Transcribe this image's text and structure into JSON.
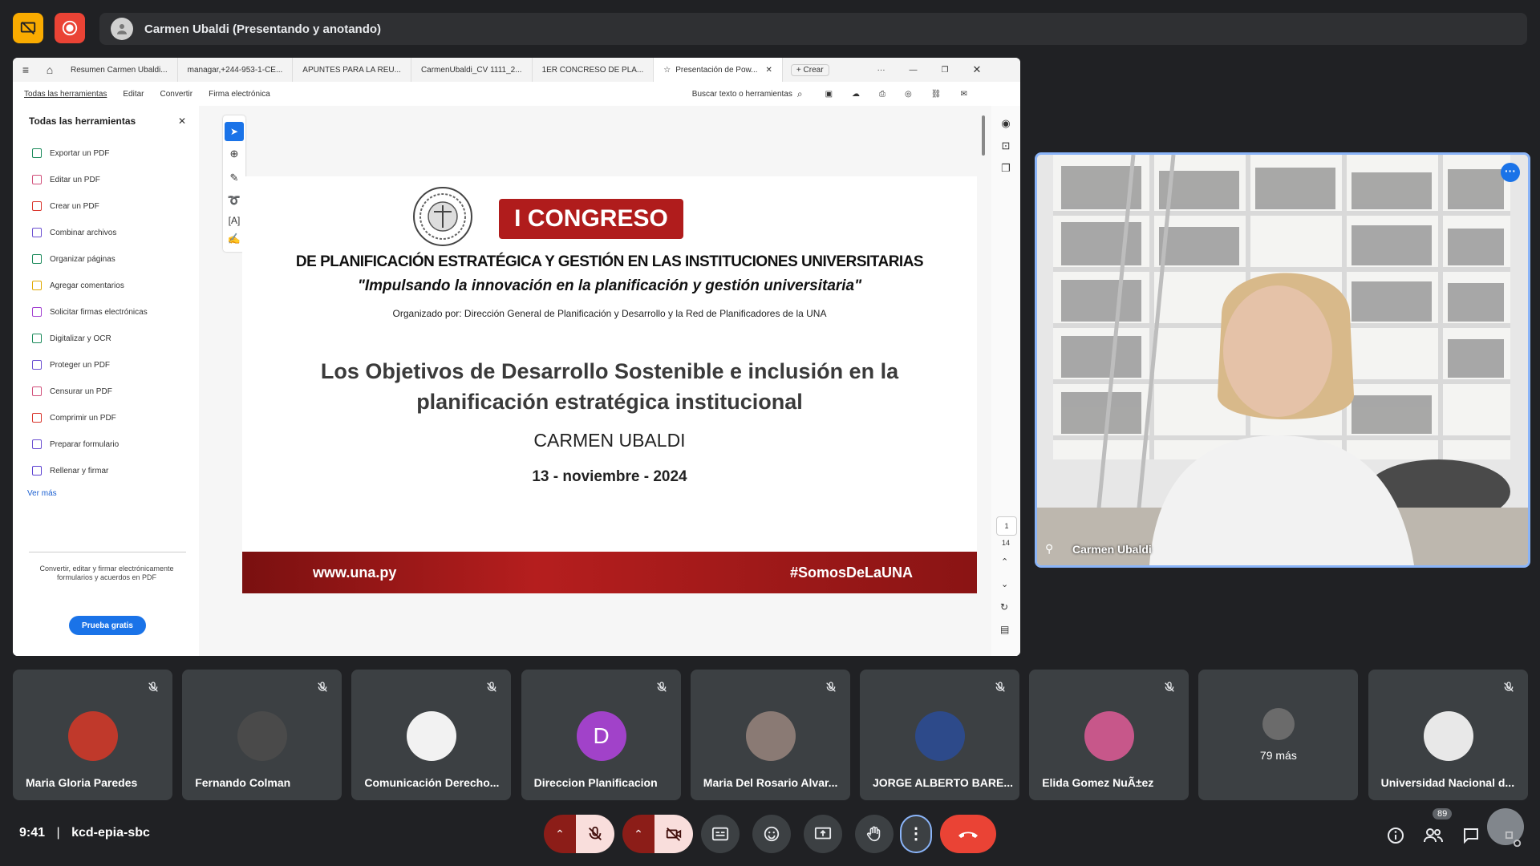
{
  "topbar": {
    "presenter_text": "Carmen Ubaldi (Presentando y anotando)",
    "present_icon_color": "#f9ab00",
    "record_icon_color": "#ea4335"
  },
  "browser": {
    "tabs": [
      "Resumen Carmen Ubaldi...",
      "managar,+244-953-1-CE...",
      "APUNTES PARA LA REU...",
      "CarmenUbaldi_CV 1111_2...",
      "1ER CONCRESO DE PLA...",
      "Presentación de Pow..."
    ],
    "new_tab_label": "+ Crear",
    "more_label": "···"
  },
  "pdf_toolbar": {
    "menu": [
      "Todas las herramientas",
      "Editar",
      "Convertir",
      "Firma electrónica"
    ],
    "search_label": "Buscar texto o herramientas"
  },
  "tools_panel": {
    "title": "Todas las herramientas",
    "items": [
      {
        "label": "Exportar un PDF",
        "color": "#1a8a5a"
      },
      {
        "label": "Editar un PDF",
        "color": "#d14f7a"
      },
      {
        "label": "Crear un PDF",
        "color": "#d9342b"
      },
      {
        "label": "Combinar archivos",
        "color": "#6b4fd1"
      },
      {
        "label": "Organizar páginas",
        "color": "#1a8a5a"
      },
      {
        "label": "Agregar comentarios",
        "color": "#e0a800"
      },
      {
        "label": "Solicitar firmas electrónicas",
        "color": "#a23fd1"
      },
      {
        "label": "Digitalizar y OCR",
        "color": "#1a8a5a"
      },
      {
        "label": "Proteger un PDF",
        "color": "#6b4fd1"
      },
      {
        "label": "Censurar un PDF",
        "color": "#d14f7a"
      },
      {
        "label": "Comprimir un PDF",
        "color": "#d9342b"
      },
      {
        "label": "Preparar formulario",
        "color": "#6b4fd1"
      },
      {
        "label": "Rellenar y firmar",
        "color": "#5b3fd1"
      }
    ],
    "see_more": "Ver más",
    "promo_text": "Convertir, editar y firmar electrónicamente formularios y acuerdos en PDF",
    "trial_button": "Prueba gratis"
  },
  "slide": {
    "badge": "I CONGRESO",
    "headline": "DE PLANIFICACIÓN ESTRATÉGICA Y GESTIÓN EN LAS INSTITUCIONES UNIVERSITARIAS",
    "tagline": "\"Impulsando la innovación en la planificación y gestión universitaria\"",
    "organizer": "Organizado por: Dirección General de Planificación y Desarrollo y la Red de Planificadores de la UNA",
    "title_line1": "Los Objetivos de Desarrollo Sostenible e inclusión en la",
    "title_line2": "planificación estratégica institucional",
    "author": "CARMEN UBALDI",
    "date": "13 - noviembre - 2024",
    "footer_left": "www.una.py",
    "footer_right": "#SomosDeLaUNA"
  },
  "page_nav": {
    "current_page": "1",
    "total_pages": "14"
  },
  "speaker": {
    "name": "Carmen Ubaldi"
  },
  "participants": [
    {
      "name": "Maria Gloria Paredes",
      "avatar_color": "#c0392b",
      "initial": ""
    },
    {
      "name": "Fernando Colman",
      "avatar_color": "#4a4a4a",
      "initial": ""
    },
    {
      "name": "Comunicación Derecho...",
      "avatar_color": "#f2f2f2",
      "initial": ""
    },
    {
      "name": "Direccion Planificacion",
      "avatar_color": "#a142c9",
      "initial": "D"
    },
    {
      "name": "Maria Del Rosario Alvar...",
      "avatar_color": "#8a7a74",
      "initial": ""
    },
    {
      "name": "JORGE ALBERTO BARE...",
      "avatar_color": "#2d4a8a",
      "initial": ""
    },
    {
      "name": "Elida Gomez NuÃ±ez",
      "avatar_color": "#c7578a",
      "initial": ""
    },
    {
      "name": "79 más",
      "avatar_color": "#6b6b6b",
      "initial": ""
    },
    {
      "name": "Universidad Nacional d...",
      "avatar_color": "#e8e8e8",
      "initial": ""
    }
  ],
  "bottombar": {
    "time": "9:41",
    "meeting_code": "kcd-epia-sbc",
    "people_count": "89",
    "hangup_color": "#ea4335",
    "muted_bg": "#f9dedc"
  }
}
